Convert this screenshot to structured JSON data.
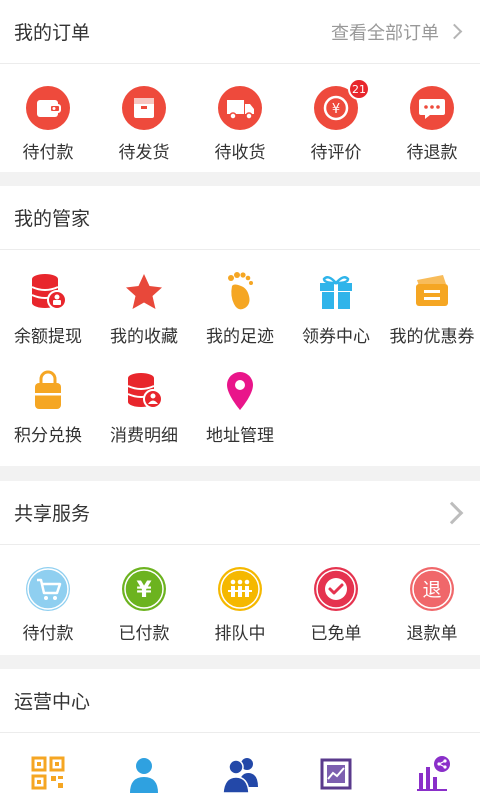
{
  "orders": {
    "title": "我的订单",
    "view_all": "查看全部订单",
    "items": [
      {
        "label": "待付款",
        "icon": "wallet-icon"
      },
      {
        "label": "待发货",
        "icon": "package-icon"
      },
      {
        "label": "待收货",
        "icon": "truck-icon"
      },
      {
        "label": "待评价",
        "icon": "yen-coin-icon",
        "badge": "21"
      },
      {
        "label": "待退款",
        "icon": "chat-bubble-icon"
      }
    ]
  },
  "butler": {
    "title": "我的管家",
    "items": [
      {
        "label": "余额提现",
        "icon": "database-lock-icon"
      },
      {
        "label": "我的收藏",
        "icon": "star-icon"
      },
      {
        "label": "我的足迹",
        "icon": "footprint-icon"
      },
      {
        "label": "领券中心",
        "icon": "gift-icon"
      },
      {
        "label": "我的优惠券",
        "icon": "coupon-icon"
      },
      {
        "label": "积分兑换",
        "icon": "bag-icon"
      },
      {
        "label": "消费明细",
        "icon": "database-user-icon"
      },
      {
        "label": "地址管理",
        "icon": "location-pin-icon"
      }
    ]
  },
  "shared": {
    "title": "共享服务",
    "items": [
      {
        "label": "待付款",
        "icon": "cart-icon"
      },
      {
        "label": "已付款",
        "icon": "yen-icon"
      },
      {
        "label": "排队中",
        "icon": "queue-icon"
      },
      {
        "label": "已免单",
        "icon": "check-icon"
      },
      {
        "label": "退款单",
        "icon": "refund-icon",
        "glyph": "退"
      }
    ]
  },
  "operations": {
    "title": "运营中心",
    "items": [
      {
        "icon": "qr-code-icon"
      },
      {
        "icon": "user-icon"
      },
      {
        "icon": "team-icon"
      },
      {
        "icon": "chart-board-icon"
      },
      {
        "icon": "share-stats-icon"
      }
    ]
  },
  "colors": {
    "background": "#f2f2f2",
    "order_red": "#ee4a3c",
    "badge_red": "#e8262c",
    "star_red": "#e8483a",
    "orange": "#f5a623",
    "sky_blue": "#2fb4ea",
    "pink": "#e9158a",
    "green": "#6cb31f",
    "crimson": "#e5334f",
    "salmon": "#f0676a",
    "navy": "#2348a8",
    "purple": "#8a2fc9"
  }
}
